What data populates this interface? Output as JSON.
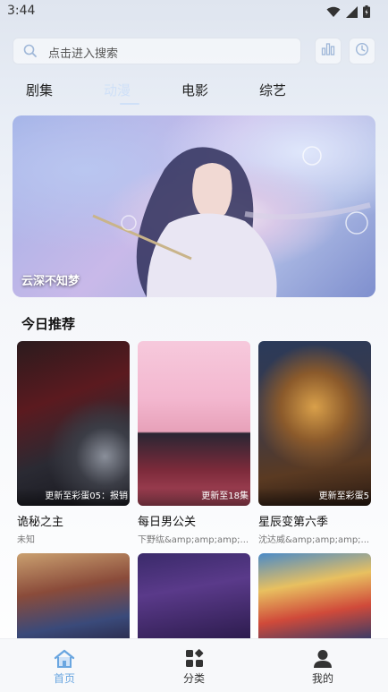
{
  "status_bar": {
    "time": "3:44"
  },
  "search": {
    "placeholder": "点击进入搜索"
  },
  "tabs": [
    {
      "label": "剧集"
    },
    {
      "label": "动漫"
    },
    {
      "label": "电影"
    },
    {
      "label": "综艺"
    }
  ],
  "banner": {
    "title": "云深不知梦"
  },
  "section": {
    "title": "今日推荐"
  },
  "cards": [
    {
      "title": "诡秘之主",
      "sub": "未知",
      "tag": "更新至彩蛋05：报销"
    },
    {
      "title": "每日男公关",
      "sub": "下野纮&amp;amp;amp;...",
      "tag": "更新至18集"
    },
    {
      "title": "星辰变第六季",
      "sub": "沈达威&amp;amp;amp;...",
      "tag": "更新至彩蛋5"
    }
  ],
  "nav": [
    {
      "label": "首页"
    },
    {
      "label": "分类"
    },
    {
      "label": "我的"
    }
  ],
  "colors": {
    "accent": "#6aa6e0",
    "tab_active": "#cfe0f7"
  }
}
